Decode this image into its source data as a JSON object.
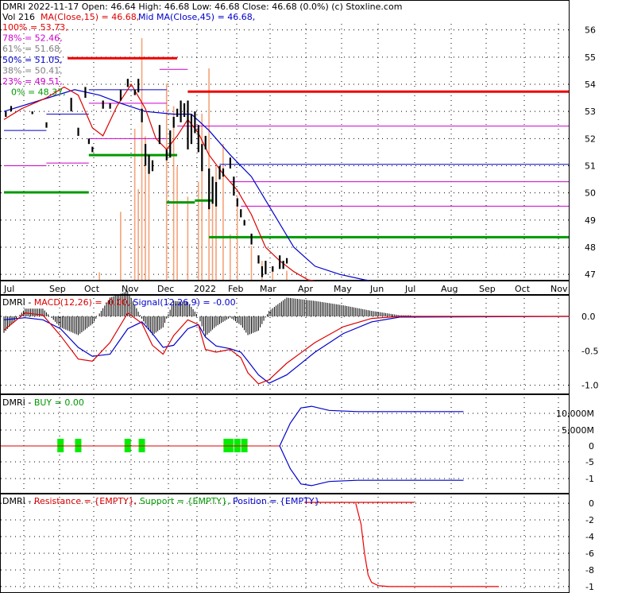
{
  "colors": {
    "background": "#ffffff",
    "grid": "#000000",
    "price_bar": "#000000",
    "volume": "#f4a37a",
    "ma15": "#dd0000",
    "ma45": "#0000cc",
    "fib": "#cc00cc",
    "resistance": "#ee0000",
    "support": "#009900",
    "buy_bar": "#00ee00",
    "position": "#0000cc",
    "label_gray": "#808080"
  },
  "price_panel": {
    "header_line1": "DMRI  2022-11-17 Open: 46.64  High: 46.68  Low: 46.68  Close: 46.68 (0.0%)  (c) Stoxline.com",
    "header_line2_vol": "Vol 216",
    "header_line2_ma15": "MA(Close,15) = 46.68,",
    "header_line2_ma45": "Mid MA(Close,45) = 46.68,",
    "fib_labels": [
      {
        "text": "100% = 53.73,",
        "color": "#ee0000"
      },
      {
        "text": "78% = 52.46,",
        "color": "#cc00cc"
      },
      {
        "text": "61% = 51.68,",
        "color": "#808080"
      },
      {
        "text": "50% = 51.05,",
        "color": "#0000cc"
      },
      {
        "text": "38% = 50.41,",
        "color": "#808080"
      },
      {
        "text": "23% = 49.51,",
        "color": "#cc00cc"
      },
      {
        "text": "0% = 48.37,",
        "color": "#009900"
      }
    ]
  },
  "chart_data": [
    {
      "type": "line",
      "panel": "price",
      "ylim": [
        46.8,
        56.4
      ],
      "y_ticks": [
        "56",
        "55",
        "54",
        "53",
        "52",
        "51",
        "50",
        "49",
        "48",
        "47"
      ],
      "x_tick_labels": [
        "Jul",
        "Sep",
        "Oct",
        "Nov",
        "Dec",
        "2022",
        "Feb",
        "Mar",
        "Apr",
        "May",
        "Jun",
        "Jul",
        "Aug",
        "Sep",
        "Oct",
        "Nov"
      ],
      "bars": [
        {
          "t": 0.5,
          "h": 53.0,
          "l": 52.8
        },
        {
          "t": 2,
          "h": 53.2,
          "l": 53.0
        },
        {
          "t": 8,
          "h": 53.0,
          "l": 52.9
        },
        {
          "t": 12,
          "h": 52.6,
          "l": 52.4
        },
        {
          "t": 19,
          "h": 53.5,
          "l": 53.0
        },
        {
          "t": 21,
          "h": 52.4,
          "l": 52.1
        },
        {
          "t": 23,
          "h": 53.9,
          "l": 53.5
        },
        {
          "t": 24,
          "h": 52.0,
          "l": 51.8
        },
        {
          "t": 25,
          "h": 51.7,
          "l": 51.5
        },
        {
          "t": 28,
          "h": 53.4,
          "l": 53.1
        },
        {
          "t": 30,
          "h": 53.3,
          "l": 53.1
        },
        {
          "t": 33,
          "h": 53.8,
          "l": 53.4
        },
        {
          "t": 35,
          "h": 54.2,
          "l": 53.9
        },
        {
          "t": 37,
          "h": 53.8,
          "l": 53.6
        },
        {
          "t": 38,
          "h": 54.2,
          "l": 53.7
        },
        {
          "t": 39,
          "h": 53.1,
          "l": 52.6
        },
        {
          "t": 40,
          "h": 51.8,
          "l": 51.0
        },
        {
          "t": 41,
          "h": 51.4,
          "l": 50.7
        },
        {
          "t": 42,
          "h": 51.2,
          "l": 50.8
        },
        {
          "t": 44,
          "h": 52.5,
          "l": 51.8
        },
        {
          "t": 46,
          "h": 51.6,
          "l": 51.2
        },
        {
          "t": 47,
          "h": 52.3,
          "l": 51.3
        },
        {
          "t": 48,
          "h": 52.8,
          "l": 52.4
        },
        {
          "t": 49,
          "h": 53.1,
          "l": 52.8
        },
        {
          "t": 50,
          "h": 53.4,
          "l": 52.6
        },
        {
          "t": 51,
          "h": 53.3,
          "l": 52.8
        },
        {
          "t": 52,
          "h": 53.4,
          "l": 51.6
        },
        {
          "t": 53,
          "h": 52.9,
          "l": 51.8
        },
        {
          "t": 54,
          "h": 53.0,
          "l": 52.2
        },
        {
          "t": 55,
          "h": 52.5,
          "l": 51.5
        },
        {
          "t": 56,
          "h": 51.8,
          "l": 50.8
        },
        {
          "t": 57,
          "h": 52.1,
          "l": 51.6
        },
        {
          "t": 58,
          "h": 50.9,
          "l": 49.4
        },
        {
          "t": 59,
          "h": 50.6,
          "l": 49.6
        },
        {
          "t": 60,
          "h": 50.4,
          "l": 49.5
        },
        {
          "t": 61,
          "h": 51.0,
          "l": 50.5
        },
        {
          "t": 62,
          "h": 50.9,
          "l": 50.6
        },
        {
          "t": 64,
          "h": 51.3,
          "l": 50.9
        },
        {
          "t": 65,
          "h": 50.6,
          "l": 49.9
        },
        {
          "t": 66,
          "h": 49.8,
          "l": 49.5
        },
        {
          "t": 67,
          "h": 49.4,
          "l": 49.1
        },
        {
          "t": 68,
          "h": 49.0,
          "l": 48.8
        },
        {
          "t": 70,
          "h": 48.5,
          "l": 48.1
        },
        {
          "t": 72,
          "h": 47.7,
          "l": 47.4
        },
        {
          "t": 73,
          "h": 47.3,
          "l": 46.9
        },
        {
          "t": 74,
          "h": 47.5,
          "l": 47.0
        },
        {
          "t": 76,
          "h": 47.3,
          "l": 47.1
        },
        {
          "t": 78,
          "h": 47.7,
          "l": 47.2
        },
        {
          "t": 79,
          "h": 47.5,
          "l": 47.2
        },
        {
          "t": 80,
          "h": 47.6,
          "l": 47.4
        }
      ],
      "ma15": [
        [
          0,
          52.7
        ],
        [
          5,
          53.1
        ],
        [
          12,
          53.5
        ],
        [
          17,
          53.9
        ],
        [
          21,
          53.6
        ],
        [
          25,
          52.4
        ],
        [
          28,
          52.1
        ],
        [
          32,
          53.2
        ],
        [
          36,
          54.0
        ],
        [
          40,
          53.1
        ],
        [
          43,
          52.0
        ],
        [
          46,
          51.6
        ],
        [
          49,
          52.1
        ],
        [
          52,
          52.7
        ],
        [
          55,
          52.2
        ],
        [
          58,
          51.4
        ],
        [
          62,
          50.7
        ],
        [
          66,
          50.1
        ],
        [
          70,
          49.2
        ],
        [
          74,
          48.0
        ],
        [
          78,
          47.5
        ],
        [
          82,
          47.1
        ],
        [
          86,
          46.8
        ],
        [
          92,
          46.68
        ],
        [
          160,
          46.68
        ]
      ],
      "ma45": [
        [
          0,
          53.0
        ],
        [
          10,
          53.4
        ],
        [
          20,
          53.8
        ],
        [
          27,
          53.6
        ],
        [
          33,
          53.3
        ],
        [
          40,
          53.0
        ],
        [
          48,
          52.9
        ],
        [
          53,
          52.9
        ],
        [
          58,
          52.3
        ],
        [
          64,
          51.4
        ],
        [
          70,
          50.6
        ],
        [
          76,
          49.3
        ],
        [
          82,
          48.0
        ],
        [
          88,
          47.3
        ],
        [
          95,
          47.0
        ],
        [
          102,
          46.8
        ],
        [
          108,
          46.68
        ],
        [
          160,
          46.68
        ]
      ],
      "volume": [
        [
          27,
          10
        ],
        [
          33,
          90
        ],
        [
          37,
          200
        ],
        [
          38,
          120
        ],
        [
          39,
          320
        ],
        [
          40,
          190
        ],
        [
          41,
          140
        ],
        [
          46,
          260
        ],
        [
          48,
          230
        ],
        [
          49,
          150
        ],
        [
          52,
          110
        ],
        [
          55,
          130
        ],
        [
          56,
          220
        ],
        [
          58,
          280
        ],
        [
          59,
          110
        ],
        [
          60,
          150
        ],
        [
          62,
          180
        ],
        [
          64,
          60
        ],
        [
          66,
          110
        ],
        [
          70,
          45
        ],
        [
          73,
          25
        ],
        [
          76,
          15
        ],
        [
          80,
          12
        ]
      ],
      "levels": [
        {
          "x0": 18,
          "x1": 49,
          "v": 54.96,
          "kind": "resistance"
        },
        {
          "x0": 52,
          "x1": 160,
          "v": 53.73,
          "kind": "resistance"
        },
        {
          "x0": 0,
          "x1": 24,
          "v": 50.02,
          "kind": "support"
        },
        {
          "x0": 24,
          "x1": 49,
          "v": 51.39,
          "kind": "support"
        },
        {
          "x0": 46,
          "x1": 54,
          "v": 49.65,
          "kind": "support"
        },
        {
          "x0": 54,
          "x1": 59,
          "v": 49.72,
          "kind": "support"
        },
        {
          "x0": 58,
          "x1": 160,
          "v": 48.37,
          "kind": "support"
        },
        {
          "x0": 49,
          "x1": 160,
          "v": 52.46,
          "kind": "fib"
        },
        {
          "x0": 61,
          "x1": 160,
          "v": 51.05,
          "kind": "fib_blue"
        },
        {
          "x0": 64,
          "x1": 160,
          "v": 50.41,
          "kind": "fib"
        },
        {
          "x0": 67,
          "x1": 160,
          "v": 49.51,
          "kind": "fib"
        },
        {
          "x0": 44,
          "x1": 52,
          "v": 54.55,
          "kind": "fib"
        },
        {
          "x0": 0,
          "x1": 12,
          "v": 51.0,
          "kind": "fib"
        },
        {
          "x0": 12,
          "x1": 24,
          "v": 51.1,
          "kind": "fib"
        },
        {
          "x0": 24,
          "x1": 46,
          "v": 52.0,
          "kind": "fib"
        },
        {
          "x0": 0,
          "x1": 12,
          "v": 52.3,
          "kind": "fib_blue"
        },
        {
          "x0": 12,
          "x1": 24,
          "v": 52.9,
          "kind": "fib_blue"
        },
        {
          "x0": 24,
          "x1": 46,
          "v": 53.8,
          "kind": "fib_blue"
        },
        {
          "x0": 24,
          "x1": 46,
          "v": 53.3,
          "kind": "fib"
        },
        {
          "x0": 87,
          "x1": 160,
          "v": 46.72,
          "kind": "black"
        }
      ]
    },
    {
      "type": "line",
      "panel": "macd",
      "header_name": "DMRI - ",
      "header_macd": "MACD(12,26) = -0.00,",
      "header_signal": "Signal(12,26,9) = -0.00",
      "ylim": [
        -1.12,
        0.3
      ],
      "y_ticks": [
        "0.0",
        "-0.5",
        "-1.0"
      ],
      "macd": [
        [
          0,
          -0.2
        ],
        [
          6,
          0.05
        ],
        [
          11,
          0.02
        ],
        [
          16,
          -0.28
        ],
        [
          21,
          -0.62
        ],
        [
          25,
          -0.65
        ],
        [
          30,
          -0.38
        ],
        [
          35,
          0.05
        ],
        [
          39,
          -0.1
        ],
        [
          42,
          -0.42
        ],
        [
          45,
          -0.55
        ],
        [
          48,
          -0.28
        ],
        [
          52,
          -0.05
        ],
        [
          55,
          -0.12
        ],
        [
          57,
          -0.48
        ],
        [
          60,
          -0.52
        ],
        [
          64,
          -0.48
        ],
        [
          67,
          -0.6
        ],
        [
          69,
          -0.82
        ],
        [
          72,
          -0.98
        ],
        [
          75,
          -0.92
        ],
        [
          80,
          -0.68
        ],
        [
          88,
          -0.38
        ],
        [
          96,
          -0.15
        ],
        [
          104,
          -0.03
        ],
        [
          112,
          0.0
        ],
        [
          160,
          0.0
        ]
      ],
      "signal": [
        [
          0,
          -0.05
        ],
        [
          6,
          -0.02
        ],
        [
          11,
          -0.05
        ],
        [
          16,
          -0.18
        ],
        [
          21,
          -0.45
        ],
        [
          25,
          -0.58
        ],
        [
          30,
          -0.55
        ],
        [
          35,
          -0.18
        ],
        [
          39,
          -0.08
        ],
        [
          42,
          -0.25
        ],
        [
          45,
          -0.45
        ],
        [
          48,
          -0.42
        ],
        [
          52,
          -0.18
        ],
        [
          55,
          -0.12
        ],
        [
          57,
          -0.3
        ],
        [
          60,
          -0.43
        ],
        [
          64,
          -0.47
        ],
        [
          67,
          -0.52
        ],
        [
          69,
          -0.65
        ],
        [
          72,
          -0.85
        ],
        [
          75,
          -0.97
        ],
        [
          80,
          -0.85
        ],
        [
          88,
          -0.52
        ],
        [
          96,
          -0.25
        ],
        [
          104,
          -0.08
        ],
        [
          112,
          -0.01
        ],
        [
          160,
          0.0
        ]
      ]
    },
    {
      "type": "line",
      "panel": "buy",
      "header_name": "DMRI - ",
      "header_buy": "BUY = 0.00",
      "y_ticks": [
        "10,000M",
        "5,000M",
        "0",
        "-5",
        "-1"
      ],
      "buy_marks": [
        16,
        21,
        35,
        39,
        63,
        64,
        66,
        68
      ],
      "upper_curve": [
        [
          78,
          0.0
        ],
        [
          81,
          0.55
        ],
        [
          84,
          0.92
        ],
        [
          87,
          0.96
        ],
        [
          92,
          0.86
        ],
        [
          100,
          0.83
        ],
        [
          130,
          0.83
        ]
      ],
      "lower_curve": [
        [
          78,
          0.0
        ],
        [
          81,
          -0.55
        ],
        [
          84,
          -0.92
        ],
        [
          87,
          -0.96
        ],
        [
          92,
          -0.86
        ],
        [
          100,
          -0.83
        ],
        [
          130,
          -0.83
        ]
      ]
    },
    {
      "type": "line",
      "panel": "rsp",
      "header_name": "DMRI - ",
      "header_resistance": "Resistance = {EMPTY},",
      "header_support": "Support = {EMPTY},",
      "header_position": "Position = {EMPTY}",
      "ylim": [
        -10.2,
        0.2
      ],
      "y_ticks": [
        "0",
        "-2",
        "-4",
        "-6",
        "-8",
        "-1"
      ],
      "position": [
        [
          0,
          0
        ],
        [
          99.5,
          0
        ],
        [
          101,
          -2.5
        ],
        [
          102,
          -6
        ],
        [
          103,
          -8.6
        ],
        [
          104,
          -9.5
        ],
        [
          106,
          -9.9
        ],
        [
          109,
          -10
        ],
        [
          140,
          -10
        ]
      ]
    }
  ]
}
